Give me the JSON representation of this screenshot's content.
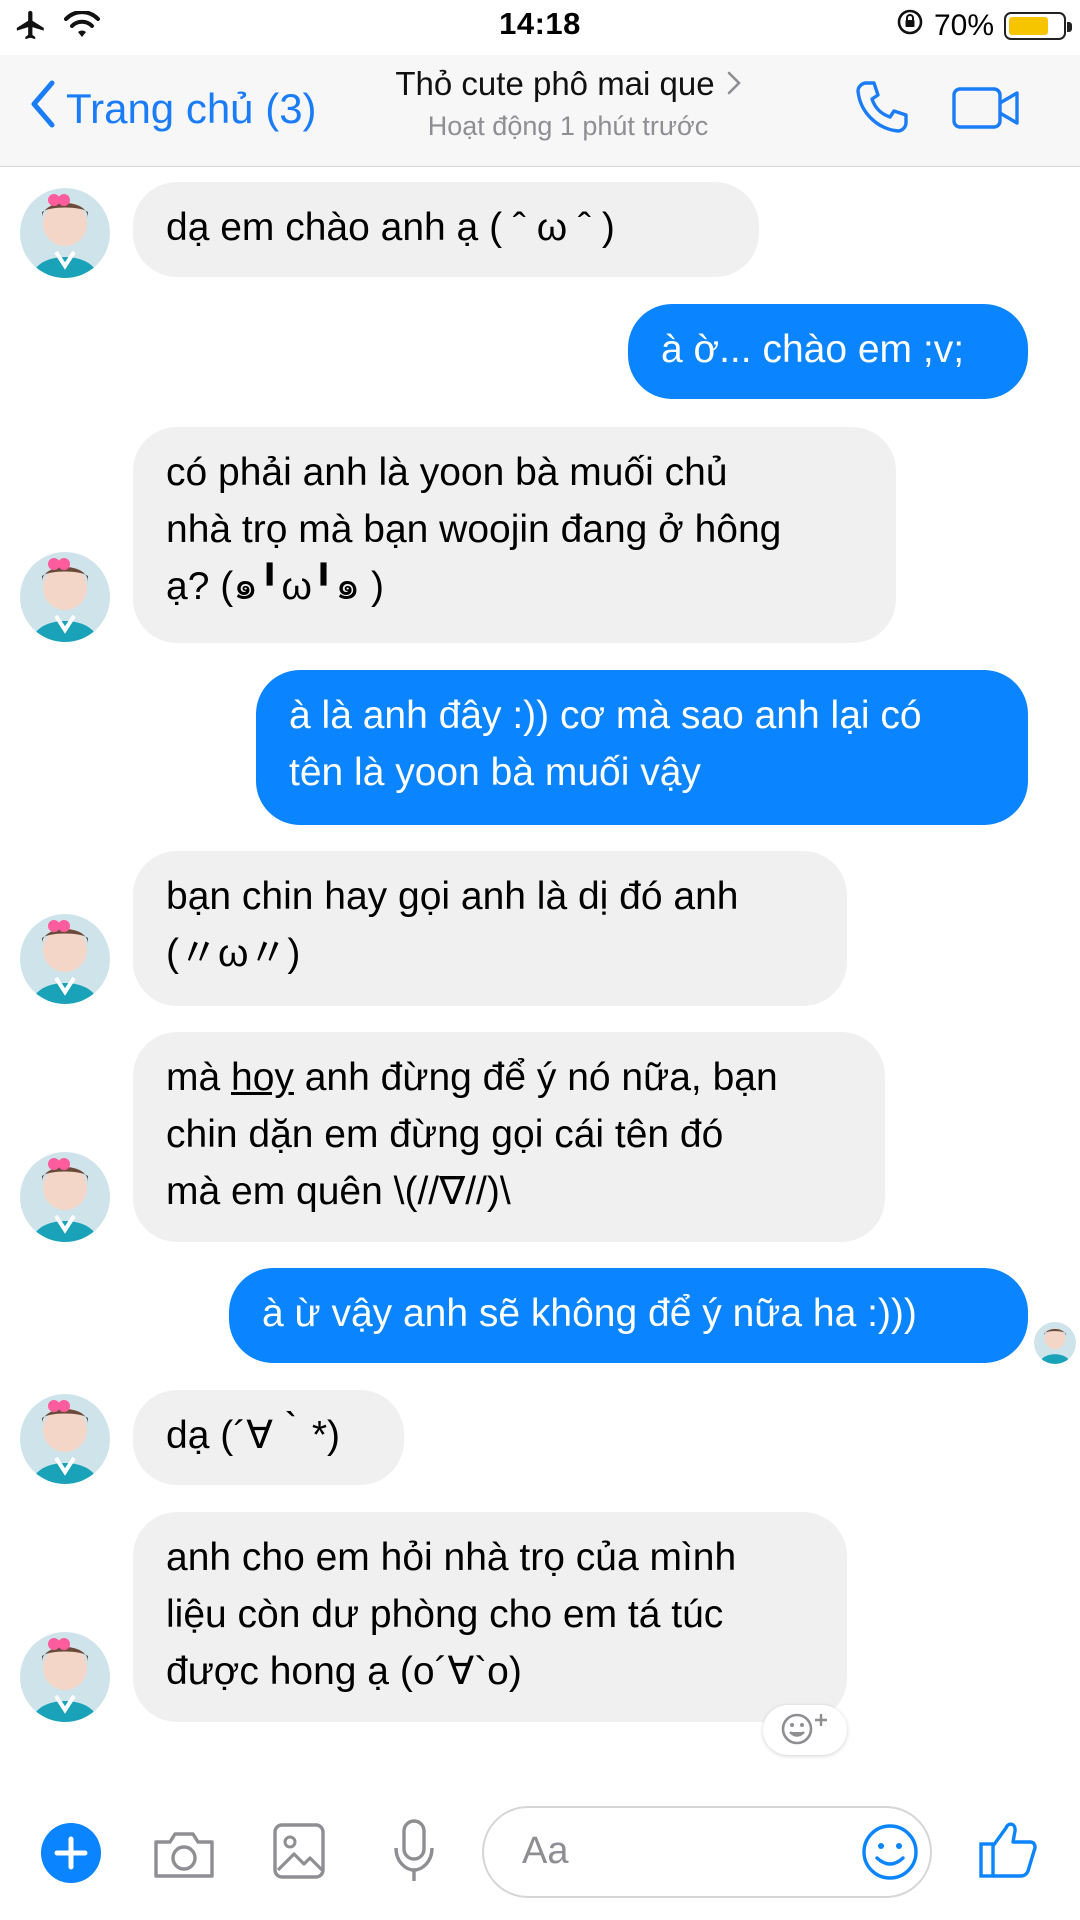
{
  "status_bar": {
    "time": "14:18",
    "battery": "70%"
  },
  "header": {
    "back_label": "Trang chủ (3)",
    "title": "Thỏ cute phô mai que",
    "subtitle": "Hoạt động 1 phút trước"
  },
  "messages": [
    {
      "sender": "contact",
      "lines": [
        "dạ em chào anh ạ  ( ˆ ω ˆ )"
      ]
    },
    {
      "sender": "me",
      "lines": [
        "à ờ... chào em ;v;"
      ]
    },
    {
      "sender": "contact",
      "lines": [
        "có phải anh là yoon bà muối chủ",
        "nhà trọ mà bạn woojin đang ở hông",
        "ạ? (๑╹ω╹๑ )"
      ]
    },
    {
      "sender": "me",
      "lines": [
        "à là anh đây :)) cơ mà sao anh lại có",
        "tên là yoon bà muối vậy"
      ]
    },
    {
      "sender": "contact",
      "lines": [
        "bạn chin hay gọi anh là dị đó anh",
        "(〃ω〃)"
      ]
    },
    {
      "sender": "contact",
      "lines": [
        "mà ",
        "hoy",
        " anh đừng để ý nó nữa, bạn",
        "chin dặn em đừng gọi cái tên đó",
        "mà em quên \\(//∇//)\\"
      ]
    },
    {
      "sender": "me",
      "lines": [
        "à ừ vậy anh sẽ không để ý nữa ha :)))"
      ]
    },
    {
      "sender": "contact",
      "lines": [
        "dạ (´∀｀*)"
      ]
    },
    {
      "sender": "contact",
      "lines": [
        "anh cho em hỏi nhà trọ của mình",
        "liệu còn dư phòng cho em tá túc",
        "được hong ạ (o´∀`o)"
      ]
    }
  ],
  "composer": {
    "placeholder": "Aa"
  },
  "colors": {
    "accent": "#0a84ff",
    "incoming_bubble": "#f0f0f0",
    "battery": "#f7c400"
  },
  "icons": [
    "airplane-icon",
    "wifi-icon",
    "orientation-lock-icon",
    "battery-icon",
    "chevron-left-icon",
    "chevron-right-icon",
    "phone-icon",
    "video-icon",
    "add-reaction-icon",
    "plus-icon",
    "camera-icon",
    "image-icon",
    "microphone-icon",
    "emoji-icon",
    "thumbs-up-icon"
  ]
}
